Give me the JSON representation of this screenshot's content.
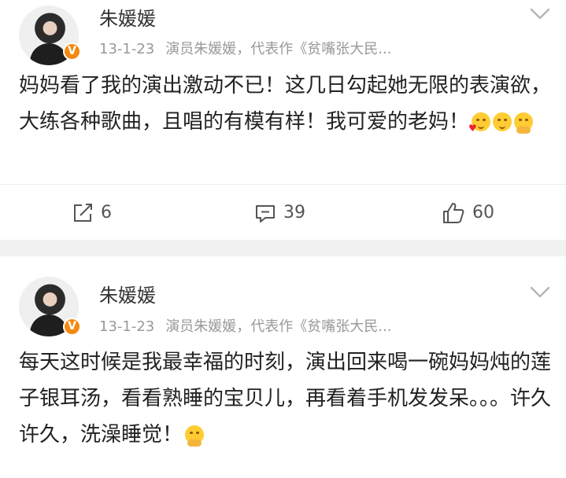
{
  "posts": [
    {
      "author": "朱媛媛",
      "date": "13-1-23",
      "source": "演员朱媛媛，代表作《贫嘴张大民...",
      "verified_badge": "V",
      "text": "妈妈看了我的演出激动不已！这几日勾起她无限的表演欲，大练各种歌曲，且唱的有模有样！我可爱的老妈！",
      "emojis": [
        "blow-kiss-emoji-icon",
        "smile-emoji-icon",
        "clap-emoji-icon"
      ],
      "actions": {
        "repost": "6",
        "comment": "39",
        "like": "60"
      }
    },
    {
      "author": "朱媛媛",
      "date": "13-1-23",
      "source": "演员朱媛媛，代表作《贫嘴张大民...",
      "verified_badge": "V",
      "text": "每天这时候是我最幸福的时刻，演出回来喝一碗妈妈炖的莲子银耳汤，看看熟睡的宝贝儿，再看着手机发发呆。。。许久许久，洗澡睡觉！",
      "emojis": [
        "happy-hands-emoji-icon"
      ]
    }
  ],
  "colors": {
    "accent_badge": "#f28a12",
    "meta_gray": "#999999",
    "separator": "#f1f1f1"
  }
}
